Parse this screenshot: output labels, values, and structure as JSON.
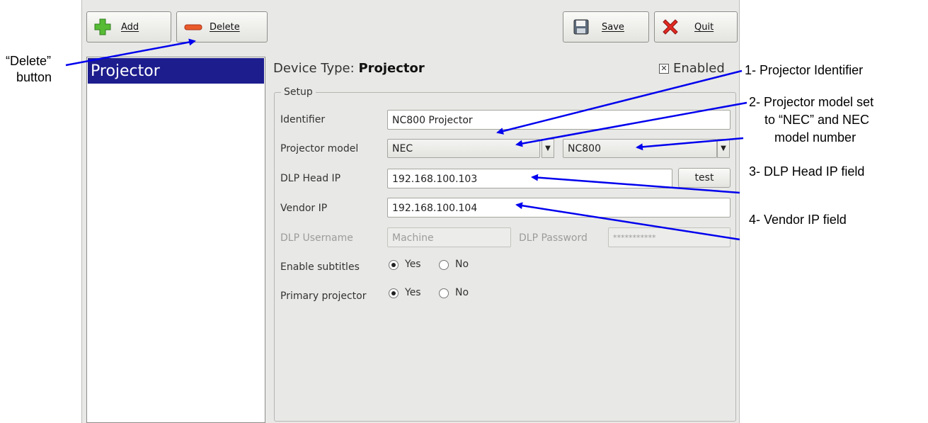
{
  "toolbar": {
    "add_label": "Add",
    "delete_label": "Delete",
    "save_label": "Save",
    "quit_label": "Quit"
  },
  "device_list": {
    "items": [
      {
        "label": "Projector",
        "selected": true
      }
    ]
  },
  "device": {
    "type_prefix": "Device Type:",
    "type_value": "Projector",
    "enabled_label": "Enabled",
    "enabled_checked": true
  },
  "setup": {
    "legend": "Setup",
    "identifier_label": "Identifier",
    "identifier_value": "NC800 Projector",
    "model_label": "Projector model",
    "model_make": "NEC",
    "model_number": "NC800",
    "dlp_ip_label": "DLP Head IP",
    "dlp_ip_value": "192.168.100.103",
    "test_label": "test",
    "vendor_ip_label": "Vendor IP",
    "vendor_ip_value": "192.168.100.104",
    "dlp_user_label": "DLP Username",
    "dlp_user_value": "Machine",
    "dlp_pass_label": "DLP Password",
    "dlp_pass_value": "***********",
    "subtitles_label": "Enable subtitles",
    "subtitles_value": "Yes",
    "primary_label": "Primary projector",
    "primary_value": "Yes",
    "yes_label": "Yes",
    "no_label": "No"
  },
  "annotations": {
    "delete_line1": "“Delete”",
    "delete_line2": "button",
    "a1": "1- Projector Identifier",
    "a2_line1": "2- Projector model set",
    "a2_line2": "to “NEC” and NEC",
    "a2_line3": "model number",
    "a3": "3- DLP Head IP field",
    "a4": "4- Vendor IP field"
  },
  "colors": {
    "selection": "#1d1d8e",
    "arrow": "#0000ee",
    "add_icon": "#4caf2f",
    "delete_icon": "#e0522a",
    "quit_icon": "#e0261e"
  }
}
